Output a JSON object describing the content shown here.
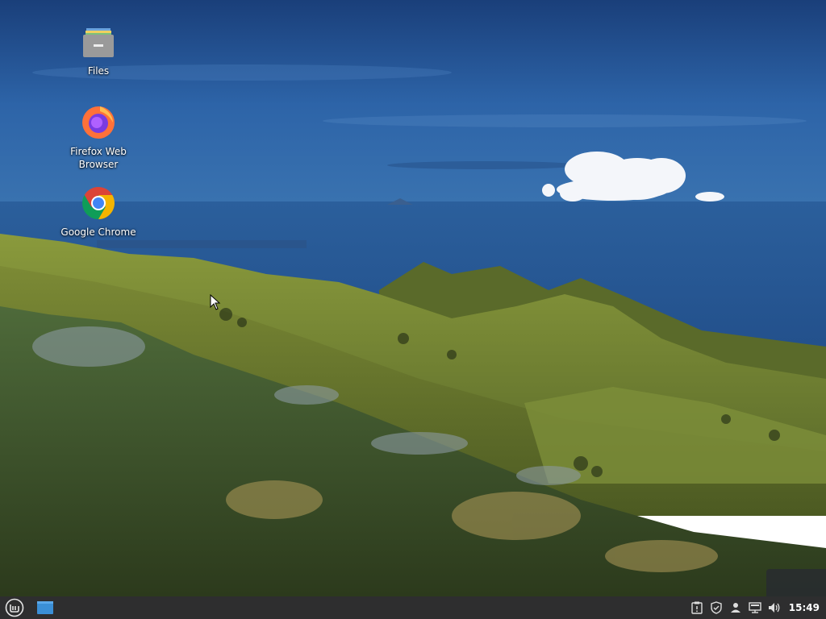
{
  "desktop": {
    "icons": [
      {
        "label": "Files",
        "icon": "folder-icon"
      },
      {
        "label": "Firefox Web Browser",
        "icon": "firefox-icon"
      },
      {
        "label": "Google Chrome",
        "icon": "chrome-icon"
      }
    ]
  },
  "taskbar": {
    "menu_icon": "linux-mint-logo-icon",
    "show_desktop_icon": "show-desktop-icon",
    "tray_icons": [
      "clipboard-icon",
      "shield-icon",
      "user-icon",
      "network-icon",
      "volume-icon"
    ],
    "clock": "15:49"
  },
  "colors": {
    "taskbar_bg": "#2e2e2f",
    "sky_top": "#1e4a8a",
    "sea": "#2a5a9a",
    "hills": "#6b7a2e"
  }
}
